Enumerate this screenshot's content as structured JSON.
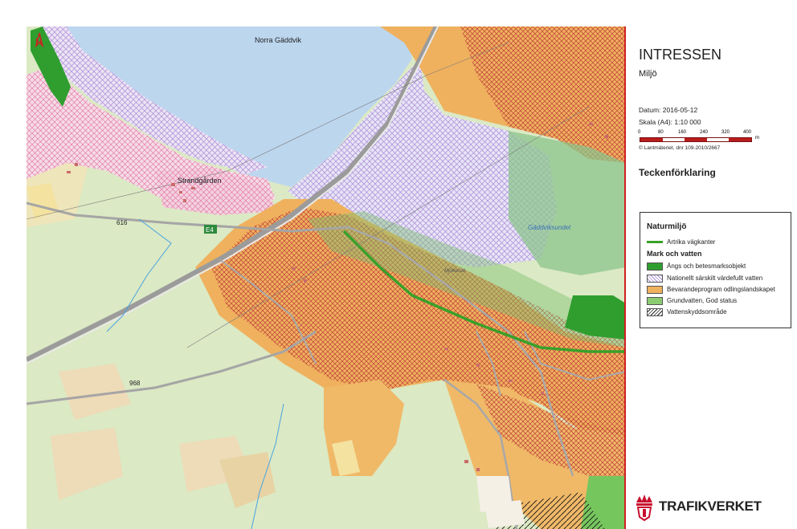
{
  "header": {
    "title": "INTRESSEN",
    "subtitle": "Miljö"
  },
  "meta": {
    "date": "Datum: 2016-05-12",
    "scale": "Skala (A4): 1:10 000",
    "scalebar_ticks": [
      "0",
      "80",
      "160",
      "240",
      "320",
      "400"
    ],
    "scalebar_unit": "m",
    "copyright": "© Lantmäteriet, dnr 109-2010/2667"
  },
  "legend_heading": "Teckenförklaring",
  "legend": {
    "title": "Naturmiljö",
    "line_item": "Artrika vägkanter",
    "section": "Mark och vatten",
    "items": [
      "Ängs och betesmarksobjekt",
      "Nationellt särskilt värdefullt vatten",
      "Bevarandeprogram odlingslandskapet",
      "Grundvatten, God status",
      "Vattenskyddsområde"
    ]
  },
  "map": {
    "north_label": "N",
    "labels": {
      "norra_gaddvik": "Norra Gäddvik",
      "strandgarden": "Strandgården",
      "road_616": "616",
      "road_968": "968",
      "road_e4": "E4",
      "gaddviksundet": "Gäddviksundet",
      "mjolkerud": "Mjölkerud"
    }
  },
  "logo": {
    "text": "TRAFIKVERKET"
  },
  "colors": {
    "frame_red": "#d02020",
    "grass": "#dbe9c4",
    "water": "#bcd6ee",
    "orange": "#efb15e",
    "dark_green": "#2f9e2f",
    "artrika_line": "#3aa02a",
    "purple_hatch": "#a98bd6",
    "pink_hatch": "#e99ab4"
  }
}
